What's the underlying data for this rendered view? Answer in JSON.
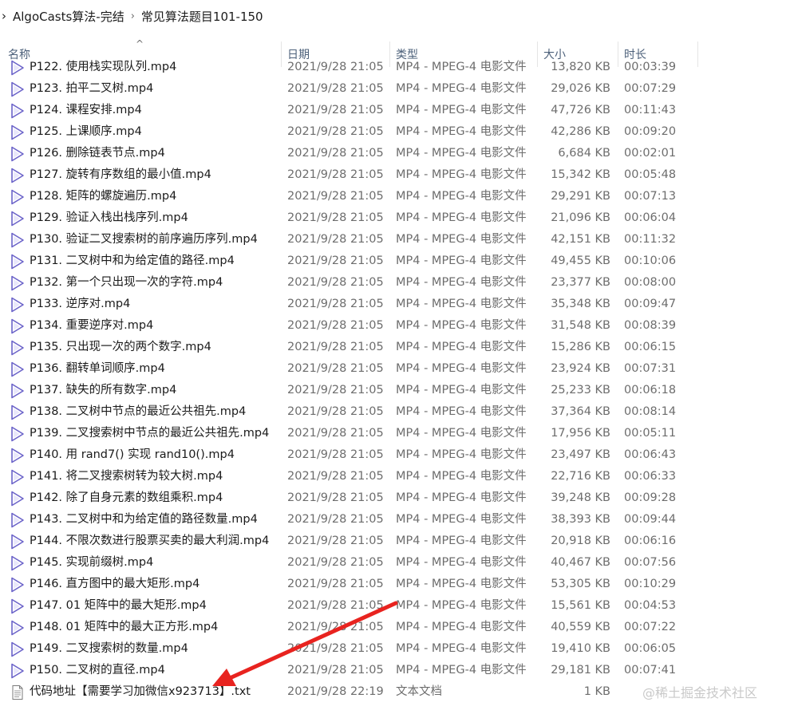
{
  "breadcrumb": {
    "lead": "›",
    "root": "AlgoCasts算法-完结",
    "separator": "›",
    "current": "常见算法题目101-150"
  },
  "columns": {
    "name": "名称",
    "date": "日期",
    "type": "类型",
    "size": "大小",
    "duration": "时长"
  },
  "sort_indicator": "^",
  "files": [
    {
      "name": "P122. 使用栈实现队列.mp4",
      "date": "2021/9/28 21:05",
      "type": "MP4 - MPEG-4 电影文件",
      "size": "13,820 KB",
      "duration": "00:03:39",
      "icon": "video-icon"
    },
    {
      "name": "P123. 拍平二叉树.mp4",
      "date": "2021/9/28 21:05",
      "type": "MP4 - MPEG-4 电影文件",
      "size": "29,026 KB",
      "duration": "00:07:29",
      "icon": "video-icon"
    },
    {
      "name": "P124. 课程安排.mp4",
      "date": "2021/9/28 21:05",
      "type": "MP4 - MPEG-4 电影文件",
      "size": "47,726 KB",
      "duration": "00:11:43",
      "icon": "video-icon"
    },
    {
      "name": "P125. 上课顺序.mp4",
      "date": "2021/9/28 21:05",
      "type": "MP4 - MPEG-4 电影文件",
      "size": "42,286 KB",
      "duration": "00:09:20",
      "icon": "video-icon"
    },
    {
      "name": "P126. 删除链表节点.mp4",
      "date": "2021/9/28 21:05",
      "type": "MP4 - MPEG-4 电影文件",
      "size": "6,684 KB",
      "duration": "00:02:01",
      "icon": "video-icon"
    },
    {
      "name": "P127. 旋转有序数组的最小值.mp4",
      "date": "2021/9/28 21:05",
      "type": "MP4 - MPEG-4 电影文件",
      "size": "15,342 KB",
      "duration": "00:05:48",
      "icon": "video-icon"
    },
    {
      "name": "P128. 矩阵的螺旋遍历.mp4",
      "date": "2021/9/28 21:05",
      "type": "MP4 - MPEG-4 电影文件",
      "size": "29,291 KB",
      "duration": "00:07:13",
      "icon": "video-icon"
    },
    {
      "name": "P129. 验证入栈出栈序列.mp4",
      "date": "2021/9/28 21:05",
      "type": "MP4 - MPEG-4 电影文件",
      "size": "21,096 KB",
      "duration": "00:06:04",
      "icon": "video-icon"
    },
    {
      "name": "P130. 验证二叉搜索树的前序遍历序列.mp4",
      "date": "2021/9/28 21:05",
      "type": "MP4 - MPEG-4 电影文件",
      "size": "42,151 KB",
      "duration": "00:11:32",
      "icon": "video-icon"
    },
    {
      "name": "P131. 二叉树中和为给定值的路径.mp4",
      "date": "2021/9/28 21:05",
      "type": "MP4 - MPEG-4 电影文件",
      "size": "49,455 KB",
      "duration": "00:10:06",
      "icon": "video-icon"
    },
    {
      "name": "P132. 第一个只出现一次的字符.mp4",
      "date": "2021/9/28 21:05",
      "type": "MP4 - MPEG-4 电影文件",
      "size": "23,377 KB",
      "duration": "00:08:00",
      "icon": "video-icon"
    },
    {
      "name": "P133. 逆序对.mp4",
      "date": "2021/9/28 21:05",
      "type": "MP4 - MPEG-4 电影文件",
      "size": "35,348 KB",
      "duration": "00:09:47",
      "icon": "video-icon"
    },
    {
      "name": "P134. 重要逆序对.mp4",
      "date": "2021/9/28 21:05",
      "type": "MP4 - MPEG-4 电影文件",
      "size": "31,548 KB",
      "duration": "00:08:39",
      "icon": "video-icon"
    },
    {
      "name": "P135. 只出现一次的两个数字.mp4",
      "date": "2021/9/28 21:05",
      "type": "MP4 - MPEG-4 电影文件",
      "size": "15,286 KB",
      "duration": "00:06:15",
      "icon": "video-icon"
    },
    {
      "name": "P136. 翻转单词顺序.mp4",
      "date": "2021/9/28 21:05",
      "type": "MP4 - MPEG-4 电影文件",
      "size": "23,924 KB",
      "duration": "00:07:31",
      "icon": "video-icon"
    },
    {
      "name": "P137. 缺失的所有数字.mp4",
      "date": "2021/9/28 21:05",
      "type": "MP4 - MPEG-4 电影文件",
      "size": "25,233 KB",
      "duration": "00:06:18",
      "icon": "video-icon"
    },
    {
      "name": "P138. 二叉树中节点的最近公共祖先.mp4",
      "date": "2021/9/28 21:05",
      "type": "MP4 - MPEG-4 电影文件",
      "size": "37,364 KB",
      "duration": "00:08:14",
      "icon": "video-icon"
    },
    {
      "name": "P139. 二叉搜索树中节点的最近公共祖先.mp4",
      "date": "2021/9/28 21:05",
      "type": "MP4 - MPEG-4 电影文件",
      "size": "17,956 KB",
      "duration": "00:05:11",
      "icon": "video-icon"
    },
    {
      "name": "P140. 用 rand7() 实现 rand10().mp4",
      "date": "2021/9/28 21:05",
      "type": "MP4 - MPEG-4 电影文件",
      "size": "23,497 KB",
      "duration": "00:06:43",
      "icon": "video-icon"
    },
    {
      "name": "P141. 将二叉搜索树转为较大树.mp4",
      "date": "2021/9/28 21:05",
      "type": "MP4 - MPEG-4 电影文件",
      "size": "22,716 KB",
      "duration": "00:06:33",
      "icon": "video-icon"
    },
    {
      "name": "P142. 除了自身元素的数组乘积.mp4",
      "date": "2021/9/28 21:05",
      "type": "MP4 - MPEG-4 电影文件",
      "size": "39,248 KB",
      "duration": "00:09:28",
      "icon": "video-icon"
    },
    {
      "name": "P143. 二叉树中和为给定值的路径数量.mp4",
      "date": "2021/9/28 21:05",
      "type": "MP4 - MPEG-4 电影文件",
      "size": "38,393 KB",
      "duration": "00:09:44",
      "icon": "video-icon"
    },
    {
      "name": "P144. 不限次数进行股票买卖的最大利润.mp4",
      "date": "2021/9/28 21:05",
      "type": "MP4 - MPEG-4 电影文件",
      "size": "20,918 KB",
      "duration": "00:06:16",
      "icon": "video-icon"
    },
    {
      "name": "P145. 实现前缀树.mp4",
      "date": "2021/9/28 21:05",
      "type": "MP4 - MPEG-4 电影文件",
      "size": "40,467 KB",
      "duration": "00:07:56",
      "icon": "video-icon"
    },
    {
      "name": "P146. 直方图中的最大矩形.mp4",
      "date": "2021/9/28 21:05",
      "type": "MP4 - MPEG-4 电影文件",
      "size": "53,305 KB",
      "duration": "00:10:29",
      "icon": "video-icon"
    },
    {
      "name": "P147. 01 矩阵中的最大矩形.mp4",
      "date": "2021/9/28 21:05",
      "type": "MP4 - MPEG-4 电影文件",
      "size": "15,561 KB",
      "duration": "00:04:53",
      "icon": "video-icon"
    },
    {
      "name": "P148. 01 矩阵中的最大正方形.mp4",
      "date": "2021/9/28 21:05",
      "type": "MP4 - MPEG-4 电影文件",
      "size": "40,559 KB",
      "duration": "00:07:22",
      "icon": "video-icon"
    },
    {
      "name": "P149. 二叉搜索树的数量.mp4",
      "date": "2021/9/28 21:05",
      "type": "MP4 - MPEG-4 电影文件",
      "size": "19,410 KB",
      "duration": "00:06:05",
      "icon": "video-icon"
    },
    {
      "name": "P150. 二叉树的直径.mp4",
      "date": "2021/9/28 21:05",
      "type": "MP4 - MPEG-4 电影文件",
      "size": "29,181 KB",
      "duration": "00:07:41",
      "icon": "video-icon"
    },
    {
      "name": "代码地址【需要学习加微信x923713】.txt",
      "date": "2021/9/28 22:19",
      "type": "文本文档",
      "size": "1 KB",
      "duration": "",
      "icon": "text-file-icon"
    }
  ],
  "watermark": "@稀土掘金技术社区",
  "colors": {
    "arrow": "#e8231f",
    "video_icon": "#6b63c9",
    "header_text": "#4c607a"
  }
}
